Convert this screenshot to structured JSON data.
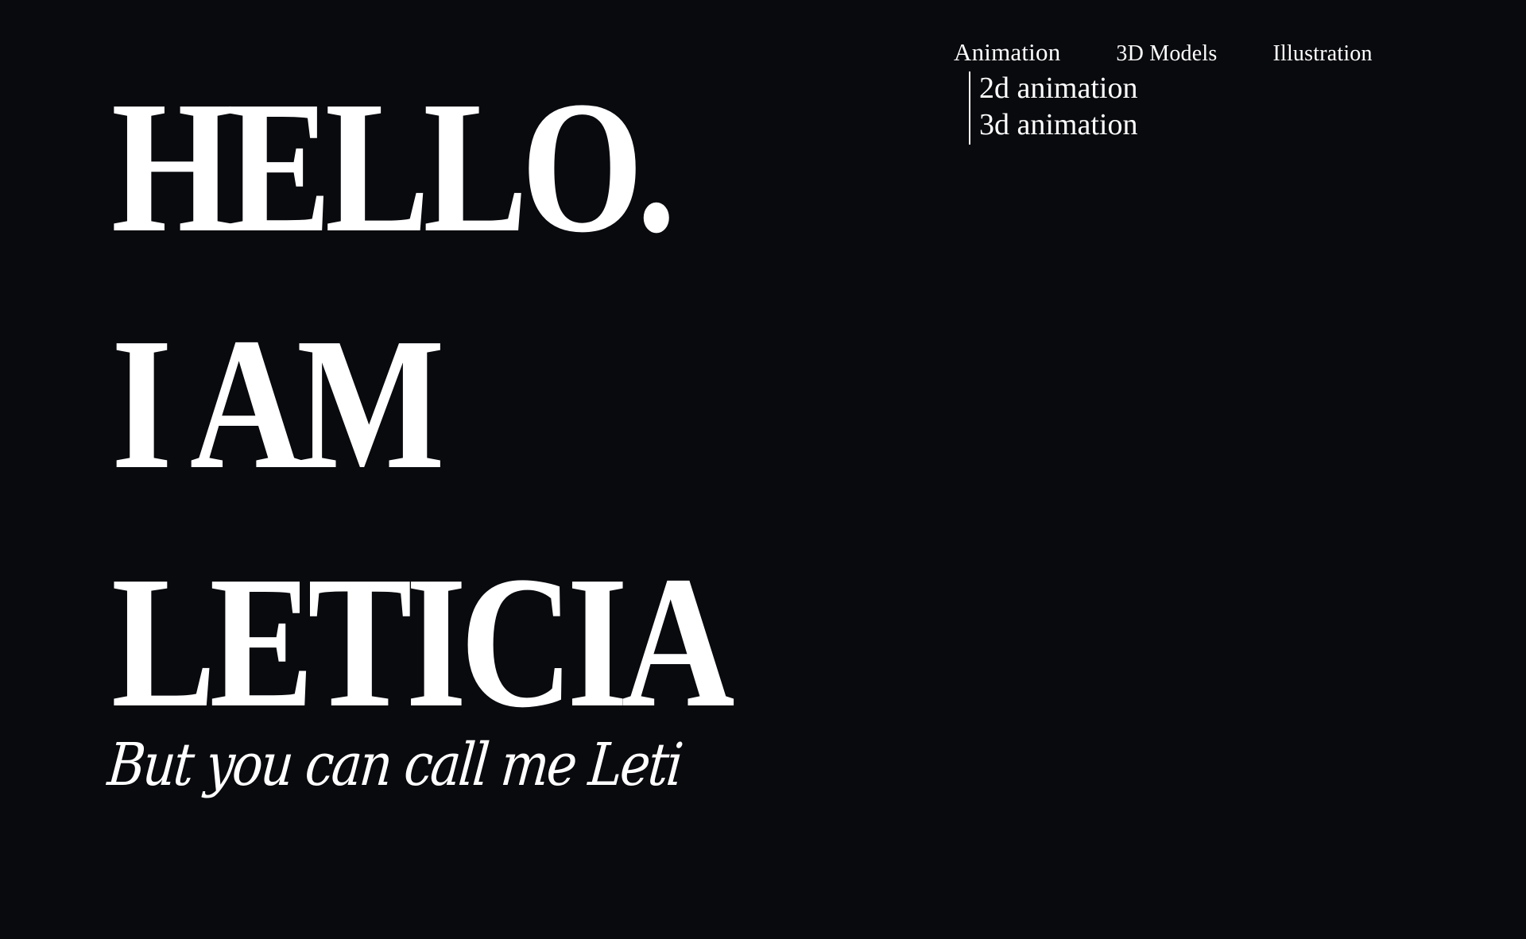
{
  "nav": {
    "items": [
      {
        "label": "Animation"
      },
      {
        "label": "3D Models"
      },
      {
        "label": "Illustration"
      }
    ]
  },
  "submenu": {
    "items": [
      {
        "label": "2d animation"
      },
      {
        "label": "3d animation"
      }
    ]
  },
  "hero": {
    "line1": "HELLO.",
    "line2": "I AM",
    "line3": "LETICIA",
    "tagline": "But you can call me Leti"
  },
  "colors": {
    "background": "#090a0e",
    "text": "#ffffff"
  }
}
